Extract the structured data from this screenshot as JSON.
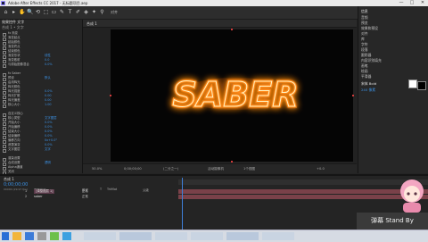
{
  "window": {
    "title": "Adobe After Effects CC 2017 - 无标题项目.aep",
    "controls": [
      "—",
      "□",
      "✕"
    ]
  },
  "toolbar": {
    "tools": [
      "⌂",
      "▸",
      "✋",
      "🔍",
      "⟲",
      "⬚",
      "▭",
      "✎",
      "T",
      "✐",
      "◈",
      "✦",
      "⚲"
    ],
    "snap_label": "对齐"
  },
  "effects_panel": {
    "tab": "效果控件 文字",
    "header": "合成 1 • 文字",
    "rows": [
      {
        "label": "fx 渐变",
        "value": ""
      },
      {
        "label": "渐变起点",
        "value": ""
      },
      {
        "label": "起始颜色",
        "value": ""
      },
      {
        "label": "渐变终点",
        "value": ""
      },
      {
        "label": "结束颜色",
        "value": ""
      },
      {
        "label": "渐变形状",
        "value": "线性"
      },
      {
        "label": "渐变散射",
        "value": "0.0"
      },
      {
        "label": "与原始图像混合",
        "value": "0.0%"
      },
      {
        "label": "",
        "value": ""
      },
      {
        "label": "fx Saber",
        "value": ""
      },
      {
        "label": "预设",
        "value": "默认"
      },
      {
        "label": "启用辉光",
        "value": ""
      },
      {
        "label": "辉光颜色",
        "value": ""
      },
      {
        "label": "辉光强度",
        "value": "0.0%"
      },
      {
        "label": "辉光扩散",
        "value": "0.00"
      },
      {
        "label": "辉光偏差",
        "value": "0.00"
      },
      {
        "label": "核心大小",
        "value": "1.00"
      },
      {
        "label": "",
        "value": ""
      },
      {
        "label": "自定义核心",
        "value": ""
      },
      {
        "label": "核心类型",
        "value": "文字图层"
      },
      {
        "label": "开始大小",
        "value": "0.0%"
      },
      {
        "label": "开始偏移",
        "value": "0.0%"
      },
      {
        "label": "结束大小",
        "value": "0.0%"
      },
      {
        "label": "结束偏移",
        "value": "0.0%"
      },
      {
        "label": "偏移方向",
        "value": "0x+0.0°"
      },
      {
        "label": "遮罩演变",
        "value": "0.0%"
      },
      {
        "label": "文字图层",
        "value": "文字"
      },
      {
        "label": "",
        "value": ""
      },
      {
        "label": "渲染设置",
        "value": ""
      },
      {
        "label": "合成设置",
        "value": "透明"
      },
      {
        "label": "Alpha通道",
        "value": ""
      },
      {
        "label": "关闭",
        "value": ""
      }
    ]
  },
  "composition": {
    "tab": "合成 1",
    "text": "SABER"
  },
  "comp_footer": {
    "zoom": "50.0%",
    "timecode": "0;00;00;00",
    "quality": "(二分之一)",
    "camera": "活动摄像机",
    "view": "1个视图",
    "exposure": "+0.0"
  },
  "right_panel": {
    "header": "信息",
    "items": [
      "音频",
      "预览",
      "效果和预设",
      "对齐",
      "库",
      "字符",
      "段落",
      "跟踪器",
      "内容识别填充",
      "画笔",
      "绘画",
      "平滑器"
    ],
    "font_label": "宋体 Bold",
    "size_label": "240 像素"
  },
  "timeline": {
    "tab": "合成 1",
    "timecode": "0;00;00;00",
    "fps": "00000 (29.97 fps)",
    "layers": [
      {
        "index": "1",
        "name": "[调整图层 1]",
        "mode": "正常"
      },
      {
        "index": "2",
        "name": "saber",
        "mode": "正常"
      }
    ],
    "column_labels": [
      "图层名称",
      "模式",
      "T",
      "TrkMat",
      "父级"
    ]
  },
  "taskbar": {
    "items": [
      "",
      "",
      "",
      "",
      "",
      "",
      "",
      ""
    ]
  },
  "overlay": {
    "standby": "弹幕 Stand By"
  }
}
